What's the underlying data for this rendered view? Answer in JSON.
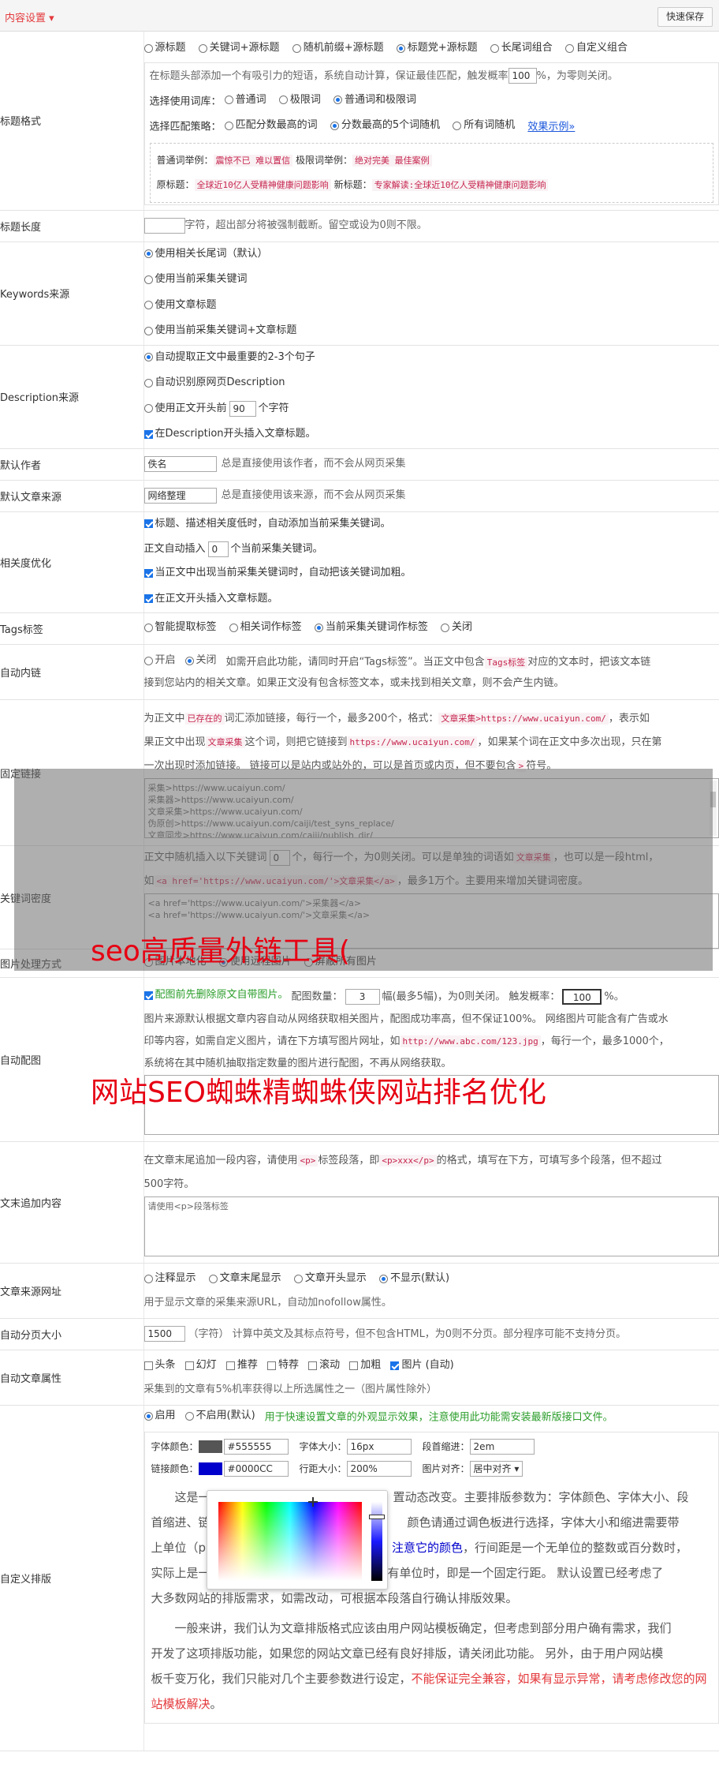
{
  "header": {
    "title": "内容设置 ▾",
    "save": "快速保存"
  },
  "title_fmt": {
    "label": "标题格式",
    "modes": [
      "源标题",
      "关键词+源标题",
      "随机前缀+源标题",
      "标题党+源标题",
      "长尾词组合",
      "自定义组合"
    ],
    "desc_a": "在标题头部添加一个有吸引力的短语，系统自动计算，保证最佳匹配，触发概率",
    "rate": "100",
    "desc_b": "%，为零则关闭。",
    "lib_label": "选择使用词库：",
    "libs": [
      "普通词",
      "极限词",
      "普通词和极限词"
    ],
    "strat_label": "选择匹配策略：",
    "strats": [
      "匹配分数最高的词",
      "分数最高的5个词随机",
      "所有词随机"
    ],
    "demo_link": "效果示例»",
    "ex1_label": "普通词举例：",
    "ex1": "震惊不已 难以置信",
    "ex2_label": "极限词举例：",
    "ex2": "绝对完美 最佳案例",
    "ex3_label": "原标题：",
    "ex3": "全球近10亿人受精神健康问题影响",
    "ex4_label": "新标题：",
    "ex4": "专家解读:全球近10亿人受精神健康问题影响"
  },
  "title_len": {
    "label": "标题长度",
    "value": "",
    "desc": "字符，超出部分将被强制截断。留空或设为0则不限。"
  },
  "keywords": {
    "label": "Keywords来源",
    "options": [
      "使用相关长尾词（默认）",
      "使用当前采集关键词",
      "使用文章标题",
      "使用当前采集关键词+文章标题"
    ]
  },
  "description": {
    "label": "Description来源",
    "o1": "自动提取正文中最重要的2-3个句子",
    "o2": "自动识别原网页Description",
    "o3a": "使用正文开头前",
    "o3n": "90",
    "o3b": "个字符",
    "o4": "在Description开头插入文章标题。"
  },
  "author": {
    "label": "默认作者",
    "value": "佚名",
    "desc": "总是直接使用该作者，而不会从网页采集"
  },
  "source": {
    "label": "默认文章来源",
    "value": "网络整理",
    "desc": "总是直接使用该来源，而不会从网页采集"
  },
  "relevance": {
    "label": "相关度优化",
    "c1": "标题、描述相关度低时，自动添加当前采集关键词。",
    "t2a": "正文自动插入",
    "n2": "0",
    "t2b": "个当前采集关键词。",
    "c3": "当正文中出现当前采集关键词时，自动把该关键词加粗。",
    "c4": "在正文开头插入文章标题。"
  },
  "tags": {
    "label": "Tags标签",
    "options": [
      "智能提取标签",
      "相关词作标签",
      "当前采集关键词作标签",
      "关闭"
    ]
  },
  "autolink": {
    "label": "自动内链",
    "on": "开启",
    "off": "关闭",
    "d1": "如需开启此功能，请同时开启“Tags标签”。当正文中包含",
    "code": "Tags标签",
    "d2": "对应的文本时，把该文本链",
    "d3": "接到您站内的相关文章。如果正文没有包含标签文本，或未找到相关文章，则不会产生内链。"
  },
  "fixedlink": {
    "label": "固定链接",
    "p1": "为正文中",
    "p1r": "已存在的",
    "p2": "词汇添加链接，每行一个，最多200个，格式：",
    "c1": "文章采集>https://www.ucaiyun.com/",
    "p3": "，表示如",
    "p4": "果正文中出现",
    "c2": "文章采集",
    "p5": "这个词，则把它链接到",
    "c3": "https://www.ucaiyun.com/",
    "p6": "，如果某个词在正文中多次出现，只在第",
    "p7": "一次出现时添加链接。 链接可以是站内或站外的，可以是首页或内页，但不要包含",
    "c4": ">",
    "p8": "符号。",
    "area": "采集>https://www.ucaiyun.com/\n采集器>https://www.ucaiyun.com/\n文章采集>https://www.ucaiyun.com/\n伪原创>https://www.ucaiyun.com/caiji/test_syns_replace/\n文章同步>https://www.ucaiyun.com/caiji/publish_dir/"
  },
  "kwdensity": {
    "label": "关键词密度",
    "a": "正文中随机插入以下关键词",
    "n": "0",
    "b": "个，每行一个，为0则关闭。可以是单独的词语如",
    "c1": "文章采集",
    "d": "，也可以是一段html，",
    "e": "如",
    "c2": "<a href='https://www.ucaiyun.com/'>文章采集</a>",
    "f": "，最多1万个。主要用来增加关键词密度。",
    "area": "<a href='https://www.ucaiyun.com/'>采集器</a>\n<a href='https://www.ucaiyun.com/'>文章采集</a>"
  },
  "imgproc": {
    "label": "图片处理方式",
    "options": [
      "图片本地化",
      "使用远程图片",
      "屏蔽所有图片"
    ]
  },
  "autoimg": {
    "label": "自动配图",
    "c1": "配图前先删除原文自带图片。",
    "a": "配图数量：",
    "n": "3",
    "b": "幅(最多5幅)，为0则关闭。 触发概率：",
    "r": "100",
    "c": "%。",
    "d1": "图片来源默认根据文章内容自动从网络获取相关图片，配图成功率高，但不保证100%。 网络图片可能含有广告或水",
    "d2": "印等内容，如需自定义图片，请在下方填写图片网址，如",
    "code": "http://www.abc.com/123.jpg",
    "d3": "，每行一个，最多1000个，",
    "d4": "系统将在其中随机抽取指定数量的图片进行配图，不再从网络获取。"
  },
  "append": {
    "label": "文末追加内容",
    "a": "在文章末尾追加一段内容，请使用",
    "c1": "<p>",
    "b": "标签段落，即",
    "c2": "<p>xxx</p>",
    "c": "的格式，填写在下方，可填写多个段落，但不超过",
    "d": "500字符。",
    "placeholder": "请使用<p>段落标签"
  },
  "srcurl": {
    "label": "文章来源网址",
    "options": [
      "注释显示",
      "文章末尾显示",
      "文章开头显示",
      "不显示(默认)"
    ],
    "desc": "用于显示文章的采集来源URL，自动加nofollow属性。"
  },
  "paging": {
    "label": "自动分页大小",
    "value": "1500",
    "desc": "（字符） 计算中英文及其标点符号，但不包含HTML，为0则不分页。部分程序可能不支持分页。"
  },
  "attrs": {
    "label": "自动文章属性",
    "options": [
      "头条",
      "幻灯",
      "推荐",
      "特荐",
      "滚动",
      "加粗",
      "图片 (自动)"
    ],
    "desc": "采集到的文章有5%机率获得以上所选属性之一（图片属性除外）"
  },
  "typeset": {
    "label": "自定义排版",
    "on": "启用",
    "off": "不启用(默认)",
    "hint": "用于快速设置文章的外观显示效果，注意使用此功能需安装最新版接口文件。",
    "fc_label": "字体颜色：",
    "fc": "#555555",
    "fs_label": "字体大小：",
    "fs": "16px",
    "pi_label": "段首缩进：",
    "pi": "2em",
    "lc_label": "链接颜色：",
    "lc": "#0000CC",
    "lh_label": "行距大小：",
    "lh": "200%",
    "ia_label": "图片对齐：",
    "ia": "居中对齐",
    "colors": {
      "font": "#555555",
      "link": "#0000CC"
    },
    "s1": "这是一",
    "s2": "置动态改变。主要排版参数为：字体颜色、字体大小、段",
    "s3": "首缩进、链",
    "s4": "颜色请通过调色板进行选择，字体大小和缩进需要带",
    "s5": "上单位（p",
    "s6": "注意它的颜色",
    "s7": "，行间距是一个无单位的整数或百分数时，",
    "s8": "实际上是一个以字体大小为基数的行距倍数；有单位时，即是一个固定行距。 默认设置已经考虑了",
    "s9": "大多数网站的排版需求，如需改动，可根据本段落自行确认排版效果。",
    "s10": "一般来讲，我们认为文章排版格式应该由用户网站模板确定，但考虑到部分用户确有需求，我们",
    "s11": "开发了这项排版功能，如果您的网站文章已经有良好排版，请关闭此功能。 另外，由于用户网站模",
    "s12": "板千变万化，我们只能对几个主要参数进行设定，",
    "s13": "不能保证完全兼容，如果有显示异常，请考虑修改您的网",
    "s14": "站模板解决",
    "s15": "。"
  },
  "overlay": {
    "t1": "seo高质量外链工具(",
    "t2": "网站SEO蜘蛛精蜘蛛侠网站排名优化"
  }
}
